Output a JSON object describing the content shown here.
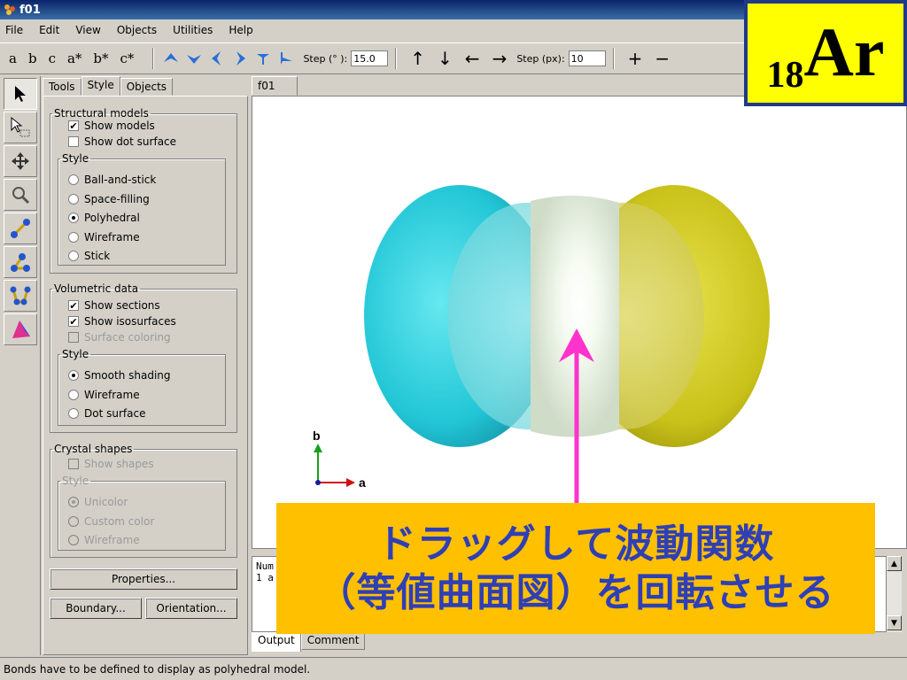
{
  "window": {
    "title": "f01"
  },
  "menu": [
    "File",
    "Edit",
    "View",
    "Objects",
    "Utilities",
    "Help"
  ],
  "toolbar": {
    "axis_buttons": [
      "a",
      "b",
      "c",
      "a*",
      "b*",
      "c*"
    ],
    "step_deg_label": "Step (° ):",
    "step_deg_value": "15.0",
    "step_px_label": "Step (px):",
    "step_px_value": "10",
    "zoom_in": "+",
    "zoom_out": "−"
  },
  "panel": {
    "tabs": [
      "Tools",
      "Style",
      "Objects"
    ],
    "active_tab": "Style",
    "structural": {
      "legend": "Structural models",
      "show_models": "Show models",
      "show_dot_surface": "Show dot surface",
      "style_legend": "Style",
      "styles": [
        "Ball-and-stick",
        "Space-filling",
        "Polyhedral",
        "Wireframe",
        "Stick"
      ],
      "selected_style": "Polyhedral"
    },
    "volumetric": {
      "legend": "Volumetric data",
      "show_sections": "Show sections",
      "show_isosurfaces": "Show isosurfaces",
      "surface_coloring": "Surface coloring",
      "style_legend": "Style",
      "styles": [
        "Smooth shading",
        "Wireframe",
        "Dot surface"
      ],
      "selected_style": "Smooth shading"
    },
    "crystal": {
      "legend": "Crystal shapes",
      "show_shapes": "Show shapes",
      "style_legend": "Style",
      "styles": [
        "Unicolor",
        "Custom color",
        "Wireframe"
      ]
    },
    "buttons": {
      "properties": "Properties...",
      "boundary": "Boundary...",
      "orientation": "Orientation..."
    }
  },
  "viewer": {
    "tab": "f01",
    "axis_b": "b",
    "axis_a": "a",
    "colors": {
      "left_lobe": "#22c6d6",
      "right_lobe": "#c9c21a",
      "middle": "#e8f0e0",
      "arrow": "#ff33cc"
    }
  },
  "output": {
    "lines": [
      "Num",
      "1 a"
    ],
    "tabs": [
      "Output",
      "Comment"
    ]
  },
  "status": "Bonds have to be defined to display as polyhedral model.",
  "badge": {
    "number": "18",
    "symbol": "Ar"
  },
  "callout": {
    "line1": "ドラッグして波動関数",
    "line2": "（等値曲面図）を回転させる"
  }
}
